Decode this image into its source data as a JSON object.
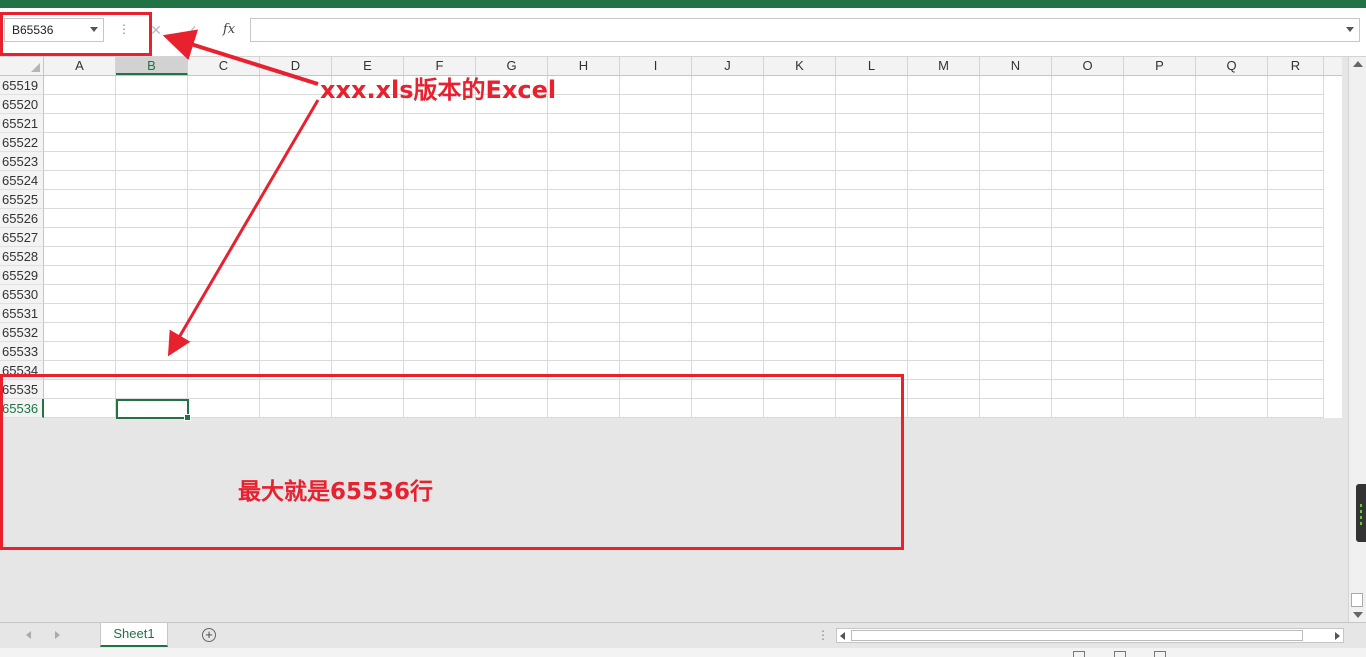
{
  "formula_bar": {
    "name_box_value": "B65536",
    "cancel_glyph": "✕",
    "enter_glyph": "✓",
    "fx_label": "fx",
    "formula_value": ""
  },
  "columns": [
    "A",
    "B",
    "C",
    "D",
    "E",
    "F",
    "G",
    "H",
    "I",
    "J",
    "K",
    "L",
    "M",
    "N",
    "O",
    "P",
    "Q",
    "R"
  ],
  "active_column": "B",
  "rows": [
    "65519",
    "65520",
    "65521",
    "65522",
    "65523",
    "65524",
    "65525",
    "65526",
    "65527",
    "65528",
    "65529",
    "65530",
    "65531",
    "65532",
    "65533",
    "65534",
    "65535",
    "65536"
  ],
  "active_row": "65536",
  "sheet_tabs": [
    {
      "label": "Sheet1",
      "active": true
    }
  ],
  "add_sheet_glyph": "+",
  "annotations": {
    "version_note": "xxx.xls版本的Excel",
    "max_rows_note": "最大就是65536行",
    "color": "#e8212f"
  },
  "theme": {
    "accent": "#217346"
  }
}
